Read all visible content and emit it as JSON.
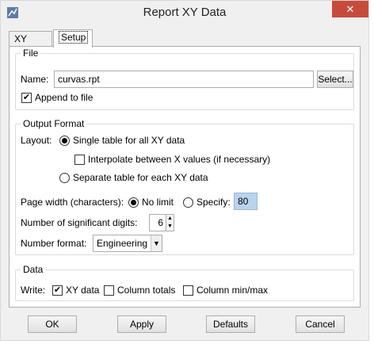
{
  "window": {
    "title": "Report XY Data",
    "close_glyph": "✕"
  },
  "tabs": [
    {
      "label": "XY Data"
    },
    {
      "label": "Setup"
    }
  ],
  "file": {
    "section_title": "File",
    "name_label": "Name:",
    "name_value": "curvas.rpt",
    "select_button": "Select...",
    "append_label": "Append to file",
    "append_checked": true
  },
  "output_format": {
    "section_title": "Output Format",
    "layout_label": "Layout:",
    "single_table_label": "Single table for all XY data",
    "interpolate_label": "Interpolate between X values (if necessary)",
    "separate_table_label": "Separate table for each XY data",
    "page_width_label": "Page width (characters):",
    "no_limit_label": "No limit",
    "specify_label": "Specify:",
    "specify_value": "80",
    "sig_digits_label": "Number of significant digits:",
    "sig_digits_value": "6",
    "number_format_label": "Number format:",
    "number_format_value": "Engineering"
  },
  "data_section": {
    "section_title": "Data",
    "write_label": "Write:",
    "xy_data_label": "XY data",
    "column_totals_label": "Column totals",
    "column_minmax_label": "Column min/max"
  },
  "buttons": {
    "ok": "OK",
    "apply": "Apply",
    "defaults": "Defaults",
    "cancel": "Cancel"
  },
  "colors": {
    "close": "#c84b3a",
    "specify_highlight": "#b8d4ee"
  }
}
